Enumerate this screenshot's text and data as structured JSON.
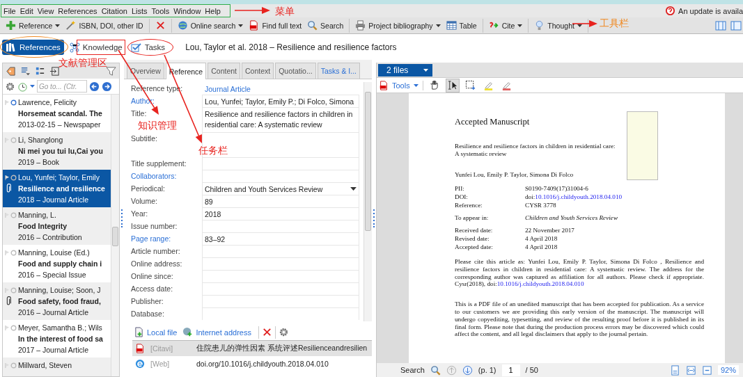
{
  "menu": [
    "File",
    "Edit",
    "View",
    "References",
    "Citation",
    "Lists",
    "Tools",
    "Window",
    "Help"
  ],
  "update_notice": "An update is availa",
  "toolbar": {
    "groups": [
      [
        {
          "kind": "text",
          "label": "Reference",
          "has_menu": true
        },
        {
          "kind": "text",
          "label": "ISBN, DOI, other ID",
          "has_menu": false
        }
      ],
      [
        {
          "kind": "icon",
          "has_menu": false
        }
      ],
      [
        {
          "kind": "text",
          "label": "Online search",
          "has_menu": true
        },
        {
          "kind": "text",
          "label": "Find full text",
          "has_menu": false
        },
        {
          "kind": "text",
          "label": "Search",
          "has_menu": false
        }
      ],
      [
        {
          "kind": "text",
          "label": "Project bibliography",
          "has_menu": true
        },
        {
          "kind": "text",
          "label": "Table",
          "has_menu": false
        }
      ],
      [
        {
          "kind": "text",
          "label": "Cite",
          "has_menu": true
        }
      ],
      [
        {
          "kind": "text",
          "label": "Thought",
          "has_menu": true
        }
      ]
    ]
  },
  "modules": [
    {
      "label": "References",
      "selected": true
    },
    {
      "label": "Knowledge",
      "selected": false
    },
    {
      "label": "Tasks",
      "selected": false
    }
  ],
  "current_title": "Lou, Taylor et al. 2018 – Resilience and resilience factors",
  "reference_list": {
    "goto_placeholder": "Go to... (Ctr.",
    "items": [
      {
        "author": "Lawrence, Felicity",
        "title": "Horsemeat scandal. The",
        "meta": "2013-02-15 – Newspaper",
        "marked": true,
        "attachment": false,
        "selected": false
      },
      {
        "author": "Li, Shanglong",
        "title": "Ni mei you tui lu,Cai you",
        "meta": "2019 – Book",
        "marked": false,
        "attachment": false,
        "selected": false
      },
      {
        "author": "Lou, Yunfei; Taylor, Emily",
        "title": "Resilience and resilience",
        "meta": "2018 – Journal Article",
        "marked": false,
        "attachment": true,
        "selected": true
      },
      {
        "author": "Manning, L.",
        "title": "Food Integrity",
        "meta": "2016 – Contribution",
        "marked": false,
        "attachment": false,
        "selected": false
      },
      {
        "author": "Manning, Louise (Ed.)",
        "title": "Food and supply chain i",
        "meta": "2016 – Special Issue",
        "marked": false,
        "attachment": false,
        "selected": false
      },
      {
        "author": "Manning, Louise; Soon, J",
        "title": "Food safety, food fraud,",
        "meta": "2016 – Journal Article",
        "marked": false,
        "attachment": true,
        "selected": false
      },
      {
        "author": "Meyer, Samantha B.; Wils",
        "title": "In the interest of food sa",
        "meta": "2017 – Journal Article",
        "marked": false,
        "attachment": false,
        "selected": false
      },
      {
        "author": "Millward, Steven",
        "marked": false,
        "attachment": false,
        "selected": false
      }
    ]
  },
  "detail_tabs": [
    {
      "label": "Overview",
      "selected": false,
      "accent": false
    },
    {
      "label": "Reference",
      "selected": true,
      "accent": false
    },
    {
      "label": "Content",
      "selected": false,
      "accent": false
    },
    {
      "label": "Context",
      "selected": false,
      "accent": false
    },
    {
      "label": "Quotatio...",
      "selected": false,
      "accent": false
    },
    {
      "label": "Tasks & I...",
      "selected": false,
      "accent": true
    }
  ],
  "fields": [
    {
      "label": "Reference type:",
      "label_link": false,
      "kind": "link",
      "value": "Journal Article"
    },
    {
      "label": "Author:",
      "label_link": true,
      "kind": "text",
      "value": "Lou, Yunfei; Taylor, Emily P.; Di Folco, Simona"
    },
    {
      "label": "Title:",
      "label_link": false,
      "kind": "multiline",
      "value": "Resilience and resilience factors in children in residential care: A systematic review"
    },
    {
      "label": "Subtitle:",
      "label_link": false,
      "kind": "multiline"
    },
    {
      "label": "Title supplement:",
      "label_link": false,
      "kind": "text"
    },
    {
      "label": "Collaborators:",
      "label_link": true,
      "kind": "text"
    },
    {
      "label": "Periodical:",
      "label_link": false,
      "kind": "dropdown",
      "value": "Children and Youth Services Review"
    },
    {
      "label": "Volume:",
      "label_link": false,
      "kind": "text",
      "value": "89"
    },
    {
      "label": "Year:",
      "label_link": false,
      "kind": "text",
      "value": "2018"
    },
    {
      "label": "Issue number:",
      "label_link": false,
      "kind": "text"
    },
    {
      "label": "Page range:",
      "label_link": true,
      "kind": "text",
      "value": "83–92"
    },
    {
      "label": "Article number:",
      "label_link": false,
      "kind": "text"
    },
    {
      "label": "Online address:",
      "label_link": false,
      "kind": "text"
    },
    {
      "label": "Online since:",
      "label_link": false,
      "kind": "text"
    },
    {
      "label": "Access date:",
      "label_link": false,
      "kind": "text"
    },
    {
      "label": "Publisher:",
      "label_link": false,
      "kind": "text"
    },
    {
      "label": "Database:",
      "label_link": false,
      "kind": "text"
    }
  ],
  "attachment_toolbar": [
    "Local file",
    "Internet address"
  ],
  "attachments": [
    {
      "kind": "pdf",
      "source": "[Citavi]",
      "name": "住院患儿的弹性因素 系统评述Resilienceandresilien",
      "selected": true
    },
    {
      "kind": "web",
      "source": "[Web]",
      "name": "doi.org/10.1016/j.childyouth.2018.04.010",
      "selected": false
    }
  ],
  "viewer": {
    "files": "2 files",
    "tools_label": "Tools",
    "tools": [
      {
        "kind": "hand",
        "selected": false
      },
      {
        "kind": "text-select",
        "selected": true
      },
      {
        "kind": "area",
        "selected": false
      },
      {
        "kind": "highlight",
        "selected": false
      },
      {
        "kind": "mark",
        "selected": false
      }
    ],
    "page": {
      "heading": "Accepted Manuscript",
      "title": "Resilience and resilience factors in children in residential care: A systematic review",
      "authors": "Yunfei Lou, Emily P. Taylor, Simona Di Folco",
      "meta_groups": [
        [
          {
            "label": "PII:",
            "value": "S0190-7409(17)31004-6"
          },
          {
            "label": "DOI:",
            "value": "doi:",
            "link": "10.1016/j.childyouth.2018.04.010"
          },
          {
            "label": "Reference:",
            "value": "CYSR 3778"
          }
        ],
        [
          {
            "label": "To appear in:",
            "value": "Children and Youth Services Review",
            "italic": true
          }
        ],
        [
          {
            "label": "Received date:",
            "value": "22 November 2017"
          },
          {
            "label": "Revised date:",
            "value": "4 April 2018"
          },
          {
            "label": "Accepted date:",
            "value": "4 April 2018"
          }
        ]
      ],
      "citation": {
        "text": "Please cite this article as: Yunfei Lou, Emily P. Taylor, Simona Di Folco , Resilience and resilience factors in children in residential care: A systematic review. The address for the corresponding author was captured as affiliation for all authors. Please check if appropriate. Cysr(2018), doi:",
        "link": "10.1016/j.childyouth.2018.04.010"
      },
      "disclaimer": "This is a PDF file of an unedited manuscript that has been accepted for publication. As a service to our customers we are providing this early version of the manuscript. The manuscript will undergo copyediting, typesetting, and review of the resulting proof before it is published in its final form. Please note that during the production process errors may be discovered which could affect the content, and all legal disclaimers that apply to the journal pertain."
    },
    "footer": {
      "search": "Search",
      "page_label": "(p. 1)",
      "page": "1",
      "total": "/ 50",
      "zoom": "92%"
    }
  },
  "annotations": [
    {
      "kind": "box",
      "color": "#2fae4a"
    },
    {
      "kind": "arrow"
    },
    {
      "kind": "label",
      "text": "菜单",
      "color": "#e8231f"
    },
    {
      "kind": "arrow"
    },
    {
      "kind": "label",
      "text": "工具栏",
      "color": "#f08a24"
    },
    {
      "kind": "ellipse",
      "color": "#f08a24"
    },
    {
      "kind": "box",
      "color": "#e8231f"
    },
    {
      "kind": "ellipse",
      "color": "#e8231f"
    },
    {
      "kind": "label",
      "text": "文献管理区",
      "color": "#e8231f"
    },
    {
      "kind": "arrow"
    },
    {
      "kind": "label",
      "text": "知识管理",
      "color": "#e8231f"
    },
    {
      "kind": "arrow"
    },
    {
      "kind": "label",
      "text": "任务栏",
      "color": "#e8231f"
    }
  ]
}
